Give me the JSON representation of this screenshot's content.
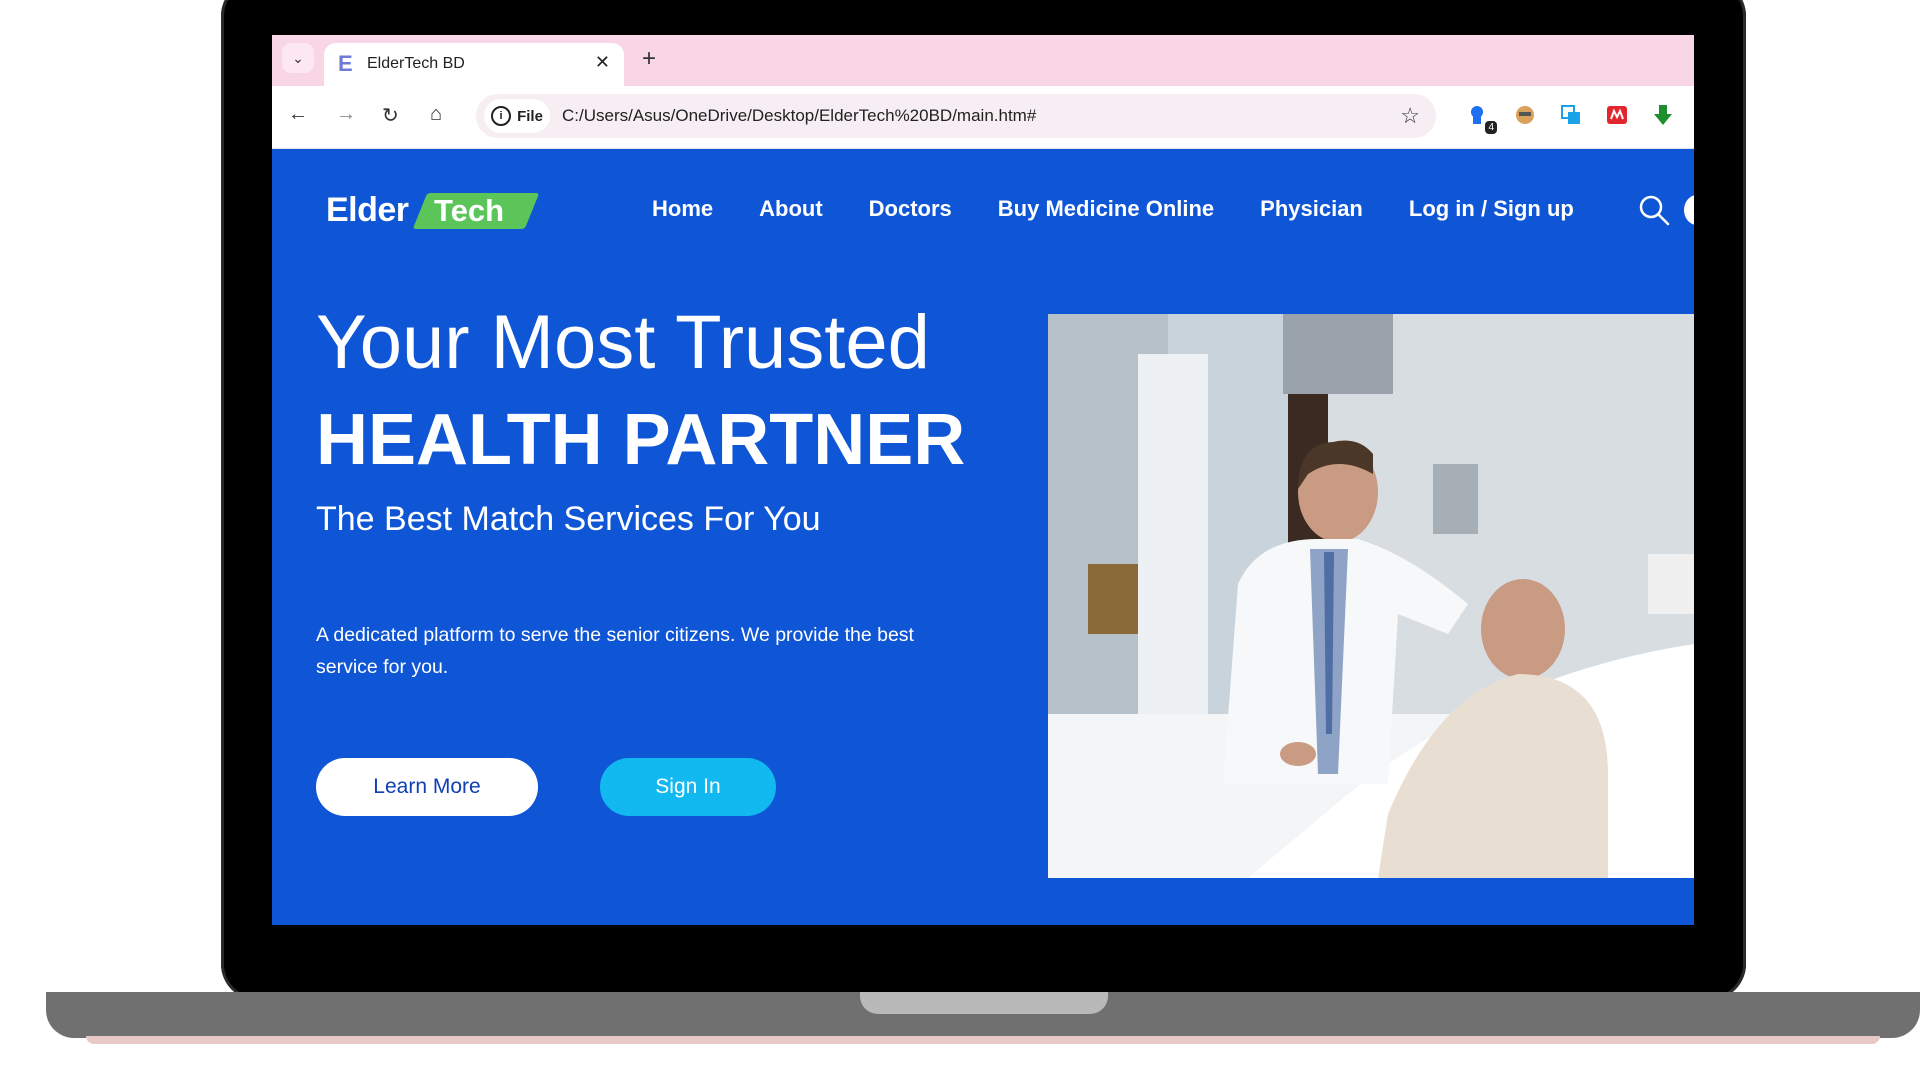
{
  "browser": {
    "tab_title": "ElderTech BD",
    "tab_favicon": "E",
    "new_tab_label": "+",
    "chip_label": "File",
    "url": "C:/Users/Asus/OneDrive/Desktop/ElderTech%20BD/main.htm#",
    "extension_badge": "4"
  },
  "site": {
    "logo_elder": "Elder",
    "logo_tech": "Tech",
    "nav": [
      "Home",
      "About",
      "Doctors",
      "Buy Medicine Online",
      "Physician",
      "Log in / Sign up"
    ],
    "hero": {
      "title_line1": "Your Most Trusted",
      "title_line2": "HEALTH PARTNER",
      "subtitle": "The Best Match Services For You",
      "description": "A dedicated platform to serve the senior citizens. We provide the best service for you.",
      "learn_more": "Learn More",
      "sign_in": "Sign In"
    }
  },
  "colors": {
    "brand_blue": "#0f56d6",
    "logo_green": "#5bc55a",
    "sign_in_cyan": "#12b8f0",
    "tabstrip_pink": "#f8d6e6"
  },
  "icons": [
    "tab-search-chevron-icon",
    "back-icon",
    "forward-icon",
    "reload-icon",
    "home-icon",
    "info-icon",
    "star-icon",
    "extension-icon",
    "search-icon"
  ]
}
